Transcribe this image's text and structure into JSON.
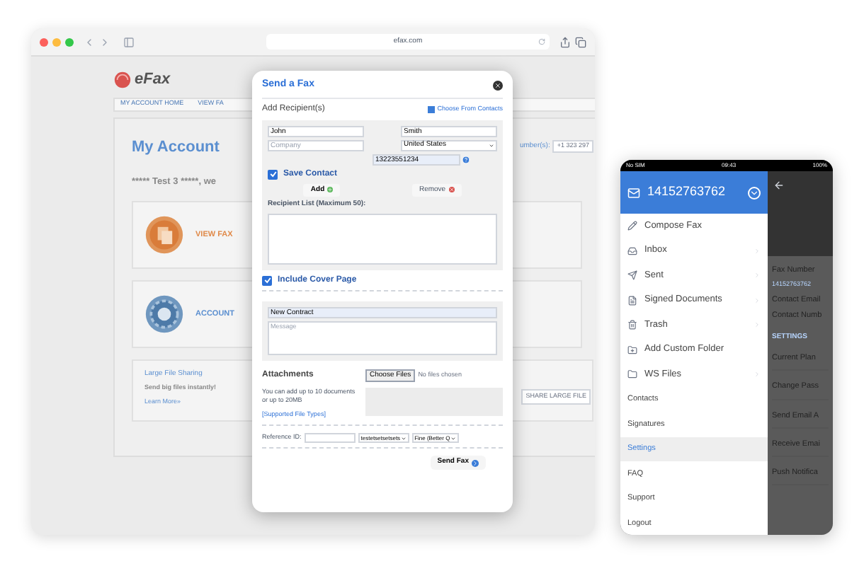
{
  "browser": {
    "url": "efax.com"
  },
  "page": {
    "logo": "eFax",
    "nav": [
      "MY ACCOUNT HOME",
      "VIEW FA"
    ],
    "heading": "My Account",
    "numbers_label": "umber(s):",
    "number": "+1 323 297",
    "greeting": "***** Test 3 *****, we",
    "cards": [
      {
        "kind": "fax",
        "title": "VIEW FAX"
      },
      {
        "kind": "account",
        "title": "ACCOUNT"
      }
    ],
    "large_file": {
      "title": "Large File Sharing",
      "subtitle": "Send big files instantly!",
      "link": "Learn More»",
      "button": "SHARE LARGE FILE"
    }
  },
  "dialog": {
    "title": "Send a Fax",
    "section": "Add Recipient(s)",
    "contacts_link": "Choose From Contacts",
    "first_name": "John",
    "last_name": "Smith",
    "company": {
      "placeholder": "Company"
    },
    "country": "United States",
    "fax_number": "13223551234",
    "save_contact": {
      "label": "Save Contact",
      "checked": true
    },
    "add_button": "Add",
    "remove_button": "Remove",
    "recipient_list_label": "Recipient List (Maximum 50):",
    "cover_page": {
      "label": "Include Cover Page",
      "checked": true
    },
    "subject": "New Contract",
    "message": {
      "placeholder": "Message"
    },
    "attachments": {
      "heading": "Attachments",
      "choose_button": "Choose Files",
      "no_file": "No files chosen",
      "note": "You can add up to 10 documents or up to 20MB",
      "types_link": "[Supported File Types]"
    },
    "reference_label": "Reference ID:",
    "sender_select": "testetsetsetsets",
    "quality_select": "Fine (Better Q",
    "send_button": "Send Fax"
  },
  "phone": {
    "carrier": "No SIM",
    "time": "09:43",
    "battery": "100%",
    "account": "14152763762",
    "menu": [
      {
        "kind": "icon",
        "label": "Compose Fax",
        "chevron": false,
        "selected": false
      },
      {
        "kind": "icon",
        "label": "Inbox",
        "chevron": true,
        "selected": false
      },
      {
        "kind": "icon",
        "label": "Sent",
        "chevron": true,
        "selected": false
      },
      {
        "kind": "icon",
        "label": "Signed Documents",
        "chevron": true,
        "selected": false
      },
      {
        "kind": "icon",
        "label": "Trash",
        "chevron": true,
        "selected": false
      },
      {
        "kind": "icon",
        "label": "Add Custom Folder",
        "chevron": false,
        "selected": false
      },
      {
        "kind": "icon",
        "label": "WS Files",
        "chevron": true,
        "selected": false
      },
      {
        "kind": "plain",
        "label": "Contacts",
        "selected": false
      },
      {
        "kind": "plain",
        "label": "Signatures",
        "selected": false
      },
      {
        "kind": "plain",
        "label": "Settings",
        "selected": true
      },
      {
        "kind": "plain",
        "label": "FAQ",
        "selected": false
      },
      {
        "kind": "plain",
        "label": "Support",
        "selected": false
      },
      {
        "kind": "plain",
        "label": "Logout",
        "selected": false
      }
    ],
    "details": [
      {
        "kind": "label",
        "text": "Fax Number"
      },
      {
        "kind": "value",
        "text": "14152763762"
      },
      {
        "kind": "label",
        "text": "Contact Email"
      },
      {
        "kind": "label",
        "text": "Contact Numb"
      },
      {
        "kind": "heading",
        "text": "SETTINGS"
      },
      {
        "kind": "row",
        "text": "Current Plan"
      },
      {
        "kind": "row",
        "text": "Change Pass"
      },
      {
        "kind": "row",
        "text": "Send Email A"
      },
      {
        "kind": "row",
        "text": "Receive Emai"
      },
      {
        "kind": "row",
        "text": "Push Notifica"
      }
    ]
  }
}
